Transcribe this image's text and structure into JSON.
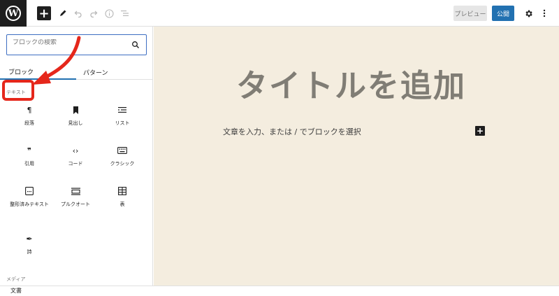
{
  "toolbar": {
    "logo_icon": "wordpress-logo",
    "logo_text": "W",
    "add_block_icon": "plus-icon",
    "tools_icon": "pencil-icon",
    "undo_icon": "undo-icon",
    "redo_icon": "redo-icon",
    "details_icon": "info-icon",
    "outline_icon": "list-view-icon",
    "preview_label": "プレビュー",
    "publish_label": "公開",
    "settings_icon": "gear-icon",
    "options_icon": "vertical-ellipsis-icon"
  },
  "inserter": {
    "search_placeholder": "ブロックの検索",
    "tabs": [
      {
        "label": "ブロック",
        "active": true
      },
      {
        "label": "パターン",
        "active": false
      }
    ],
    "category_text": "テキスト",
    "blocks": [
      {
        "label": "段落",
        "icon": "paragraph-icon",
        "glyph": "¶"
      },
      {
        "label": "見出し",
        "icon": "bookmark-icon",
        "glyph": ""
      },
      {
        "label": "リスト",
        "icon": "list-icon",
        "glyph": ""
      },
      {
        "label": "引用",
        "icon": "quote-icon",
        "glyph": "❞"
      },
      {
        "label": "コード",
        "icon": "code-icon",
        "glyph": "‹›"
      },
      {
        "label": "クラシック",
        "icon": "keyboard-icon",
        "glyph": ""
      },
      {
        "label": "整形済みテキスト",
        "icon": "preformatted-icon",
        "glyph": ""
      },
      {
        "label": "プルクオート",
        "icon": "pullquote-icon",
        "glyph": ""
      },
      {
        "label": "表",
        "icon": "table-icon",
        "glyph": ""
      },
      {
        "label": "詩",
        "icon": "feather-pen-icon",
        "glyph": "✒"
      }
    ],
    "category_media": "メディア"
  },
  "editor": {
    "title_placeholder": "タイトルを追加",
    "paragraph_placeholder": "文章を入力、または / でブロックを選択",
    "add_block_icon": "plus-icon"
  },
  "footer": {
    "breadcrumb": "文書"
  },
  "colors": {
    "accent": "#2271b1",
    "canvas_background": "#f4eddf",
    "annotation_red": "#e5271b",
    "title_color": "#807d75"
  },
  "annotations": {
    "arrow": "red-arrow-pointing-to-category",
    "highlight": "red-rounded-box-around-category-label"
  }
}
